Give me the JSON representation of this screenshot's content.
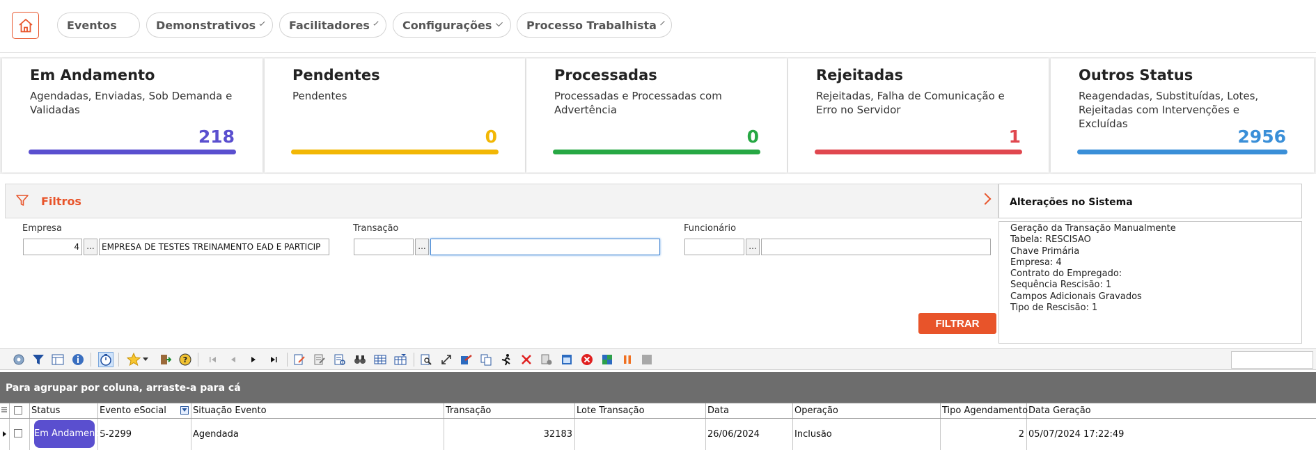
{
  "nav": {
    "items": [
      {
        "label": "Eventos",
        "has_dropdown": false
      },
      {
        "label": "Demonstrativos",
        "has_dropdown": true
      },
      {
        "label": "Facilitadores",
        "has_dropdown": true
      },
      {
        "label": "Configurações",
        "has_dropdown": true
      },
      {
        "label": "Processo Trabalhista",
        "has_dropdown": true
      }
    ]
  },
  "cards": [
    {
      "title": "Em Andamento",
      "subtitle": "Agendadas, Enviadas, Sob Demanda e Validadas",
      "count": "218",
      "color": "#5a4fcf"
    },
    {
      "title": "Pendentes",
      "subtitle": "Pendentes",
      "count": "0",
      "color": "#f2b705"
    },
    {
      "title": "Processadas",
      "subtitle": "Processadas e Processadas com Advertência",
      "count": "0",
      "color": "#27a844"
    },
    {
      "title": "Rejeitadas",
      "subtitle": "Rejeitadas, Falha de Comunicação e Erro no Servidor",
      "count": "1",
      "color": "#e0474f"
    },
    {
      "title": "Outros Status",
      "subtitle": "Reagendadas, Substituídas, Lotes, Rejeitadas com Intervenções e Excluídas",
      "count": "2956",
      "color": "#3a8fd8"
    }
  ],
  "filters": {
    "title": "Filtros",
    "empresa": {
      "label": "Empresa",
      "code": "4",
      "lookup": "...",
      "name": "EMPRESA DE TESTES TREINAMENTO EAD E PARTICIP"
    },
    "transacao": {
      "label": "Transação",
      "code": "",
      "lookup": "...",
      "name": ""
    },
    "funcionario": {
      "label": "Funcionário",
      "code": "",
      "lookup": "...",
      "name": ""
    },
    "submit_label": "FILTRAR"
  },
  "changes_panel": {
    "title": "Alterações no Sistema",
    "lines": [
      "Geração da Transação Manualmente",
      "Tabela: RESCISAO",
      "Chave Primária",
      "Empresa: 4",
      "Contrato do Empregado:",
      "Sequência Rescisão: 1",
      "Campos Adicionais Gravados",
      "Tipo de Rescisão: 1"
    ]
  },
  "grid": {
    "group_hint": "Para agrupar por coluna, arraste-a para cá",
    "columns": [
      "Status",
      "Evento eSocial",
      "Situação Evento",
      "Transação",
      "Lote Transação",
      "Data",
      "Operação",
      "Tipo Agendamento",
      "Data Geração"
    ],
    "rows": [
      {
        "status": "Em Andamento",
        "evento": "S-2299",
        "situacao": "Agendada",
        "transacao": "32183",
        "lote": "",
        "data": "26/06/2024",
        "operacao": "Inclusão",
        "tipo_agendamento": "2",
        "data_geracao": "05/07/2024 17:22:49"
      }
    ]
  },
  "colors": {
    "accent": "#e8542a",
    "status_em_andamento": "#5a4fcf",
    "group_bar": "#6d6d6d"
  }
}
